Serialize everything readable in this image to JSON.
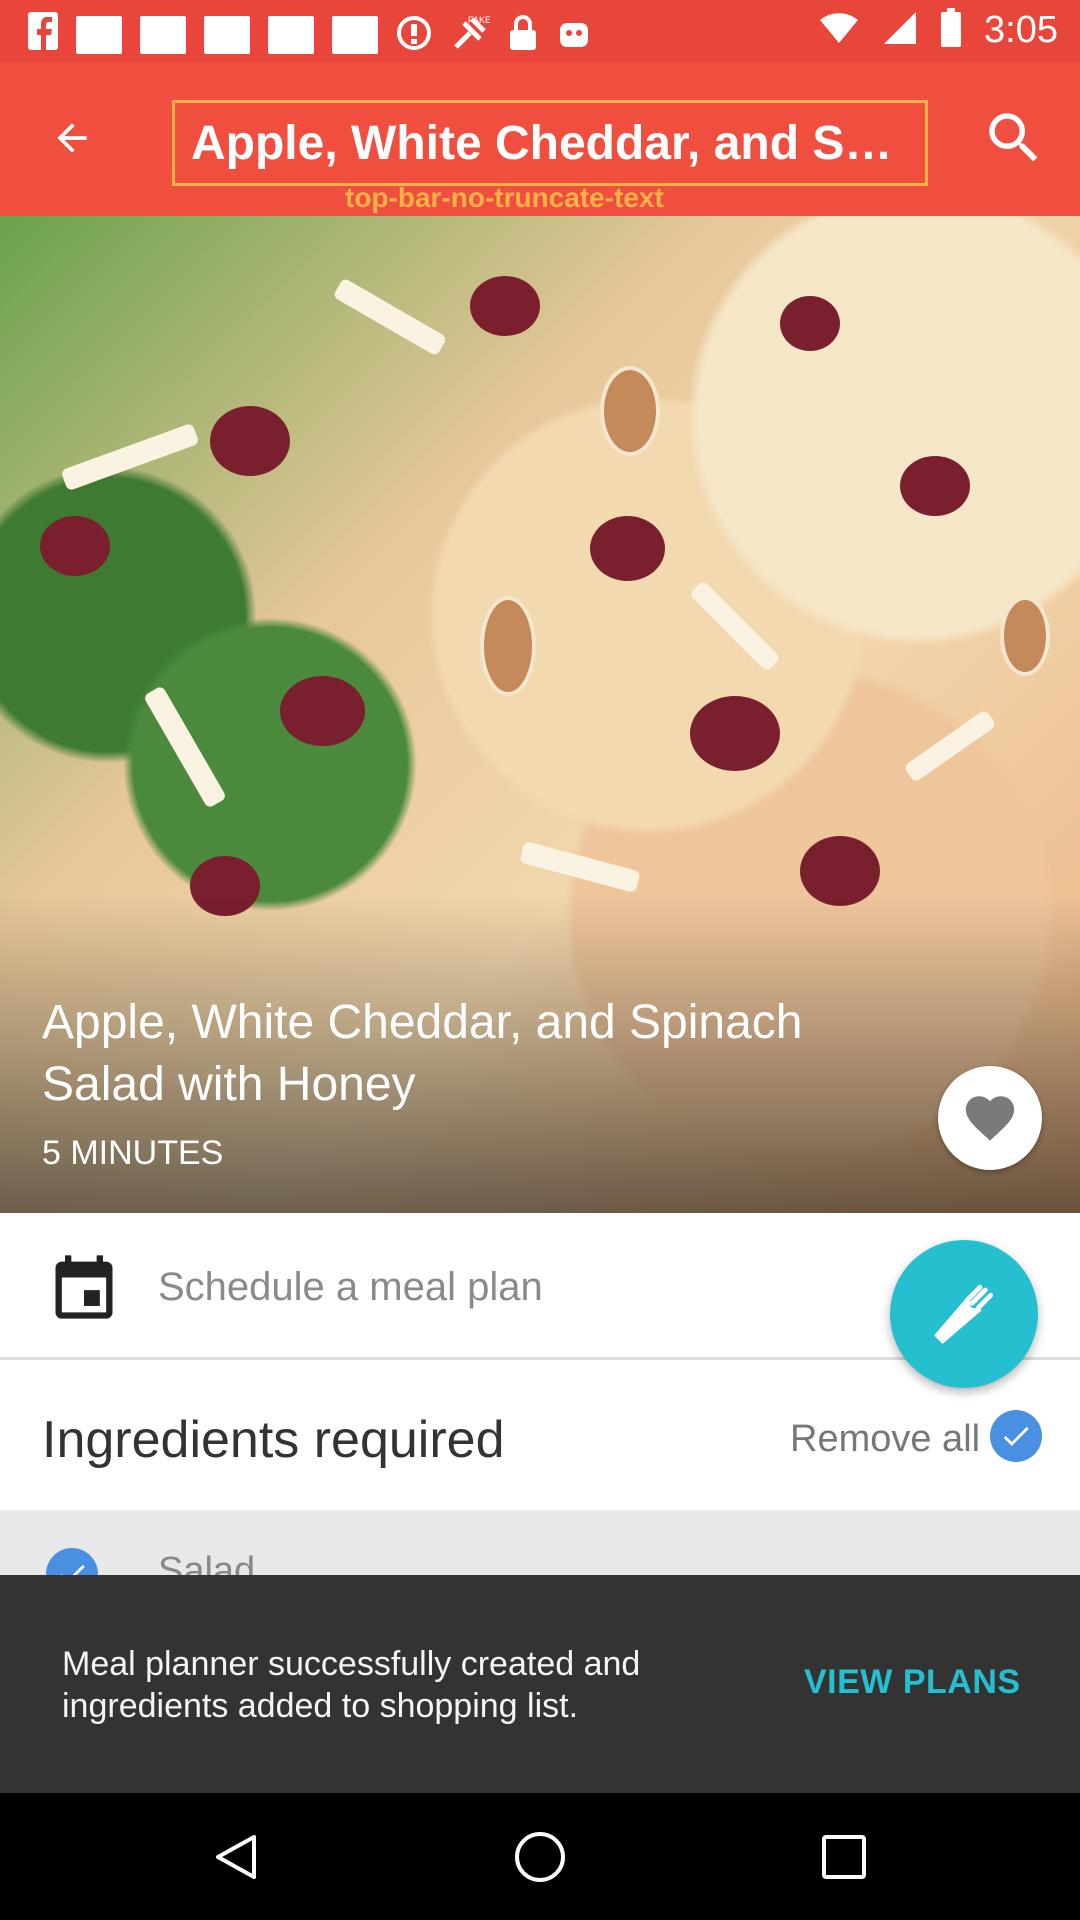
{
  "status_bar": {
    "time": "3:05",
    "icons": [
      "facebook-icon",
      "notification-square-icon",
      "notification-square-icon",
      "notification-square-icon",
      "notification-square-icon",
      "notification-square-icon",
      "blocked-icon",
      "fake-gps-icon",
      "lock-icon",
      "android-icon",
      "wifi-icon",
      "signal-icon",
      "battery-icon"
    ]
  },
  "app_bar": {
    "title": "Apple, White Cheddar, and Spinach Salad with Honey",
    "debug_label": "top-bar-no-truncate-text",
    "back_icon": "arrow-back-icon",
    "search_icon": "search-icon"
  },
  "recipe": {
    "title": "Apple, White Cheddar, and Spinach Salad with Honey",
    "time": "5 MINUTES"
  },
  "schedule": {
    "label": "Schedule a meal plan"
  },
  "ingredients": {
    "title": "Ingredients required",
    "remove_all": "Remove all",
    "items": [
      {
        "label": "Salad"
      }
    ]
  },
  "snackbar": {
    "message": "Meal planner successfully created and ingredients added to shopping list.",
    "action": "VIEW PLANS"
  },
  "colors": {
    "app_bar": "#f04e3e",
    "status_bar": "#e8463b",
    "accent": "#26bfcf",
    "check": "#4a90e2",
    "snackbar": "#333333"
  }
}
